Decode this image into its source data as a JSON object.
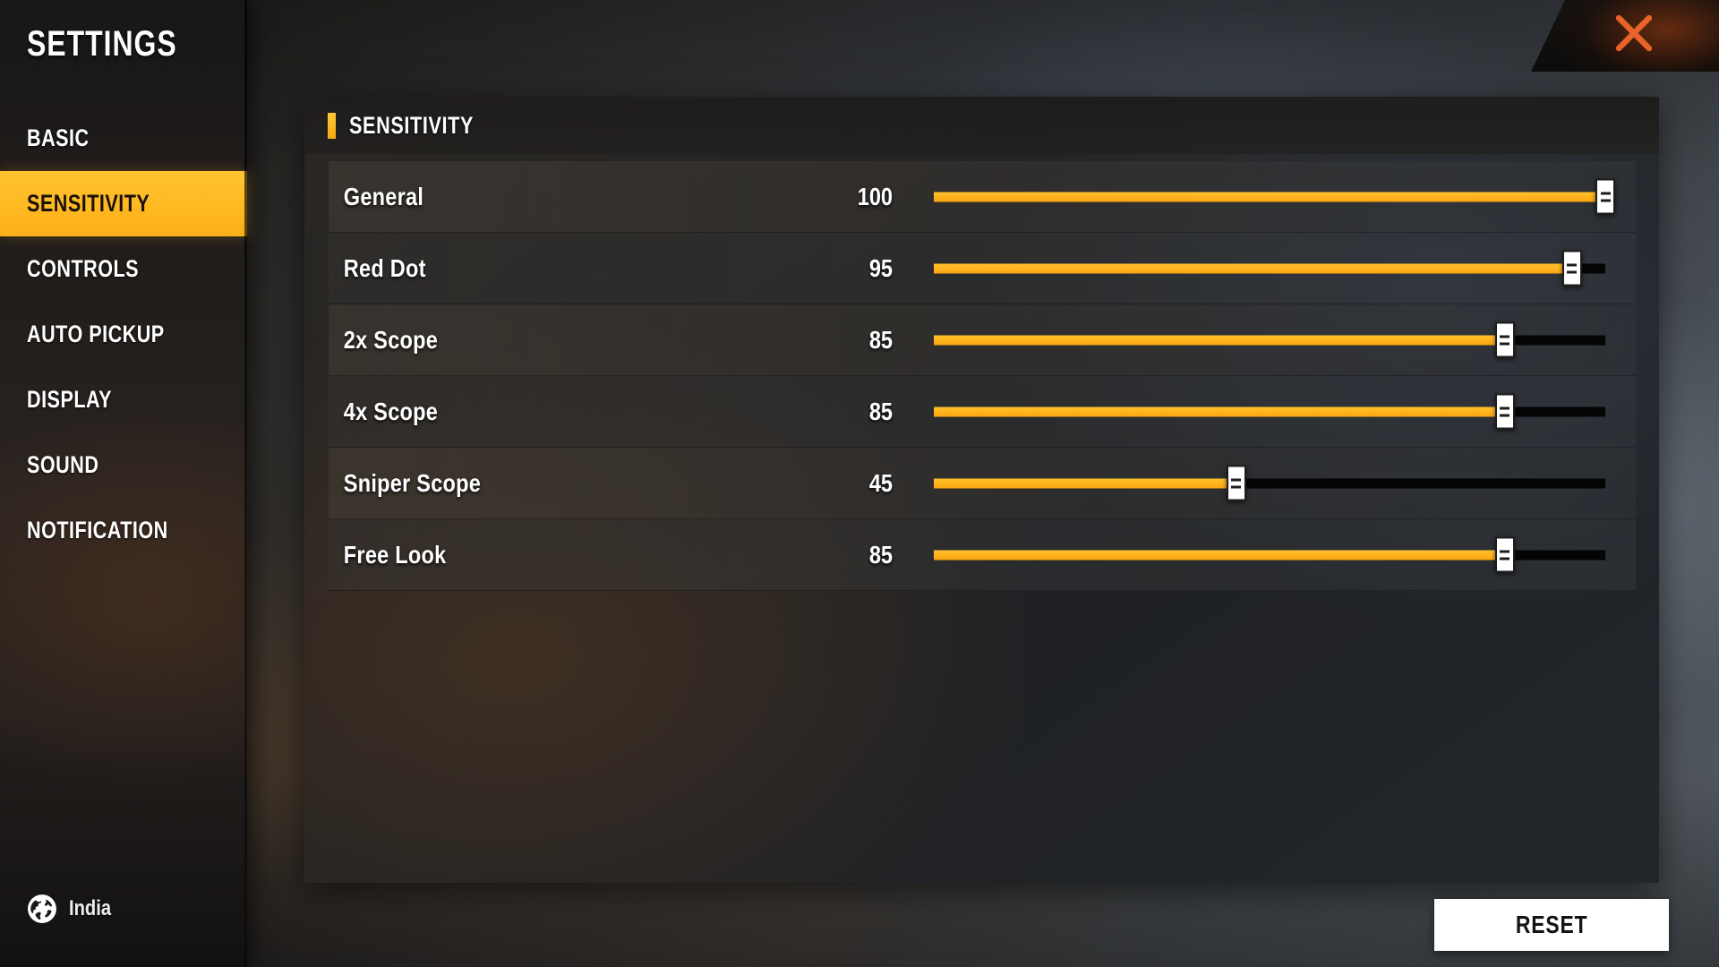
{
  "window": {
    "title": "SETTINGS",
    "close_icon": "close-x-icon",
    "accent_color": "#ffb822",
    "close_color": "#e8622a"
  },
  "sidebar": {
    "title": "SETTINGS",
    "items": [
      {
        "label": "BASIC",
        "active": false
      },
      {
        "label": "SENSITIVITY",
        "active": true
      },
      {
        "label": "CONTROLS",
        "active": false
      },
      {
        "label": "AUTO PICKUP",
        "active": false
      },
      {
        "label": "DISPLAY",
        "active": false
      },
      {
        "label": "SOUND",
        "active": false
      },
      {
        "label": "NOTIFICATION",
        "active": false
      }
    ],
    "locale": {
      "icon": "globe-icon",
      "label": "India"
    }
  },
  "main": {
    "section_title": "SENSITIVITY",
    "min": 0,
    "max": 100,
    "rows": [
      {
        "label": "General",
        "value": "100",
        "percent": 100
      },
      {
        "label": "Red Dot",
        "value": "95",
        "percent": 95
      },
      {
        "label": "2x Scope",
        "value": "85",
        "percent": 85
      },
      {
        "label": "4x Scope",
        "value": "85",
        "percent": 85
      },
      {
        "label": "Sniper Scope",
        "value": "45",
        "percent": 45
      },
      {
        "label": "Free Look",
        "value": "85",
        "percent": 85
      }
    ]
  },
  "footer": {
    "reset_label": "RESET"
  }
}
